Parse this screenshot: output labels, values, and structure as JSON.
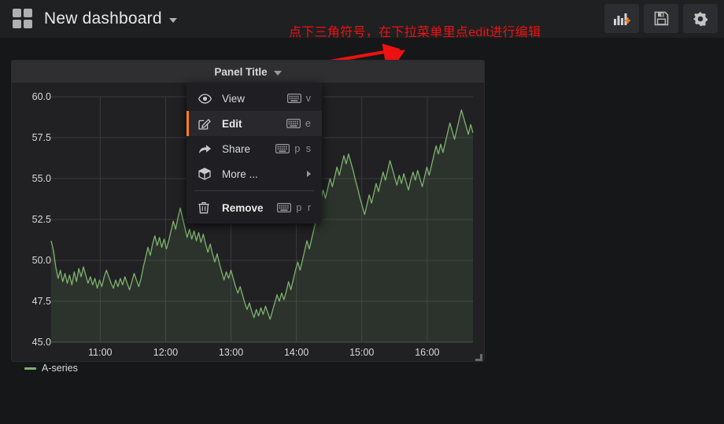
{
  "navbar": {
    "dashboard_icon": "dashboard-grid-icon",
    "title": "New dashboard",
    "caret_icon": "chevron-down-icon",
    "buttons": [
      {
        "name": "add-panel-button",
        "icon": "add-panel-icon",
        "label": ""
      },
      {
        "name": "save-dashboard-button",
        "icon": "save-floppy-icon",
        "label": ""
      },
      {
        "name": "dashboard-settings-button",
        "icon": "gear-icon",
        "label": ""
      }
    ]
  },
  "annotation": {
    "text": "点下三角符号，在下拉菜单里点edit进行编辑",
    "color": "#ee1111",
    "arrow_count": 2
  },
  "panel": {
    "title": "Panel Title",
    "caret_icon": "chevron-down-icon",
    "resize_handle": "panel-resize-handle"
  },
  "menu": {
    "items": [
      {
        "label": "View",
        "icon": "eye-icon",
        "keys": "v",
        "kbd_icon": "keyboard-icon",
        "active": false,
        "submenu": false
      },
      {
        "label": "Edit",
        "icon": "pencil-square-icon",
        "keys": "e",
        "kbd_icon": "keyboard-icon",
        "active": true,
        "submenu": false
      },
      {
        "label": "Share",
        "icon": "share-arrow-icon",
        "keys": "p s",
        "kbd_icon": "keyboard-icon",
        "active": false,
        "submenu": false
      },
      {
        "label": "More ...",
        "icon": "cube-icon",
        "keys": "",
        "kbd_icon": "",
        "active": false,
        "submenu": true
      }
    ],
    "remove": {
      "label": "Remove",
      "icon": "trash-icon",
      "keys": "p r",
      "kbd_icon": "keyboard-icon"
    }
  },
  "chart_data": {
    "type": "line",
    "title": "Panel Title",
    "xlabel": "",
    "ylabel": "",
    "ylim": [
      45.0,
      60.0
    ],
    "yticks": [
      "45.0",
      "47.5",
      "50.0",
      "52.5",
      "55.0",
      "57.5",
      "60.0"
    ],
    "ytick_values": [
      45.0,
      47.5,
      50.0,
      52.5,
      55.0,
      57.5,
      60.0
    ],
    "xticks": [
      "11:00",
      "12:00",
      "13:00",
      "14:00",
      "15:00",
      "16:00"
    ],
    "xlim": [
      "10:35",
      "16:10"
    ],
    "grid": true,
    "legend_position": "bottom-left",
    "series": [
      {
        "name": "A-series",
        "color": "#7eb26d",
        "fill": true,
        "values": [
          51.2,
          50.6,
          49.6,
          48.9,
          49.4,
          48.7,
          49.2,
          48.6,
          49.1,
          48.5,
          49.3,
          48.7,
          49.5,
          49.0,
          49.6,
          49.1,
          48.6,
          49.0,
          48.5,
          48.9,
          48.3,
          48.8,
          48.4,
          49.0,
          49.4,
          49.0,
          48.6,
          48.3,
          48.8,
          48.4,
          48.9,
          48.5,
          49.0,
          48.6,
          48.2,
          48.7,
          49.2,
          48.8,
          48.4,
          48.9,
          49.6,
          50.2,
          50.8,
          50.3,
          51.0,
          51.5,
          50.9,
          51.4,
          50.8,
          51.3,
          50.7,
          51.2,
          51.8,
          52.4,
          51.9,
          52.6,
          53.2,
          52.6,
          52.0,
          51.4,
          51.9,
          51.3,
          51.8,
          51.2,
          51.7,
          51.1,
          51.6,
          51.0,
          50.5,
          51.0,
          50.4,
          49.9,
          50.4,
          49.8,
          49.3,
          48.8,
          49.3,
          48.9,
          49.4,
          48.9,
          48.4,
          48.0,
          48.4,
          47.9,
          47.4,
          47.0,
          47.4,
          46.9,
          46.5,
          47.0,
          46.6,
          47.1,
          46.7,
          47.2,
          46.8,
          46.4,
          46.9,
          47.4,
          47.9,
          47.5,
          48.0,
          47.6,
          48.1,
          48.7,
          48.2,
          48.8,
          49.4,
          49.9,
          49.4,
          50.0,
          50.6,
          51.2,
          50.7,
          51.3,
          51.9,
          52.5,
          53.1,
          53.7,
          54.3,
          53.8,
          54.4,
          55.0,
          54.5,
          55.1,
          55.7,
          55.2,
          55.8,
          56.4,
          55.9,
          56.5,
          56.0,
          55.5,
          54.9,
          54.4,
          53.8,
          53.3,
          52.8,
          53.4,
          54.0,
          53.5,
          54.1,
          54.7,
          54.2,
          54.8,
          55.4,
          54.9,
          55.5,
          56.1,
          55.6,
          55.1,
          54.6,
          55.2,
          54.7,
          55.3,
          54.8,
          54.3,
          54.9,
          55.4,
          54.9,
          55.5,
          55.0,
          54.5,
          55.1,
          55.7,
          55.2,
          55.8,
          56.4,
          57.0,
          56.5,
          57.1,
          56.6,
          57.2,
          57.8,
          58.4,
          57.9,
          57.4,
          58.0,
          58.6,
          59.2,
          58.7,
          58.2,
          57.7,
          58.3,
          57.8
        ]
      }
    ]
  }
}
